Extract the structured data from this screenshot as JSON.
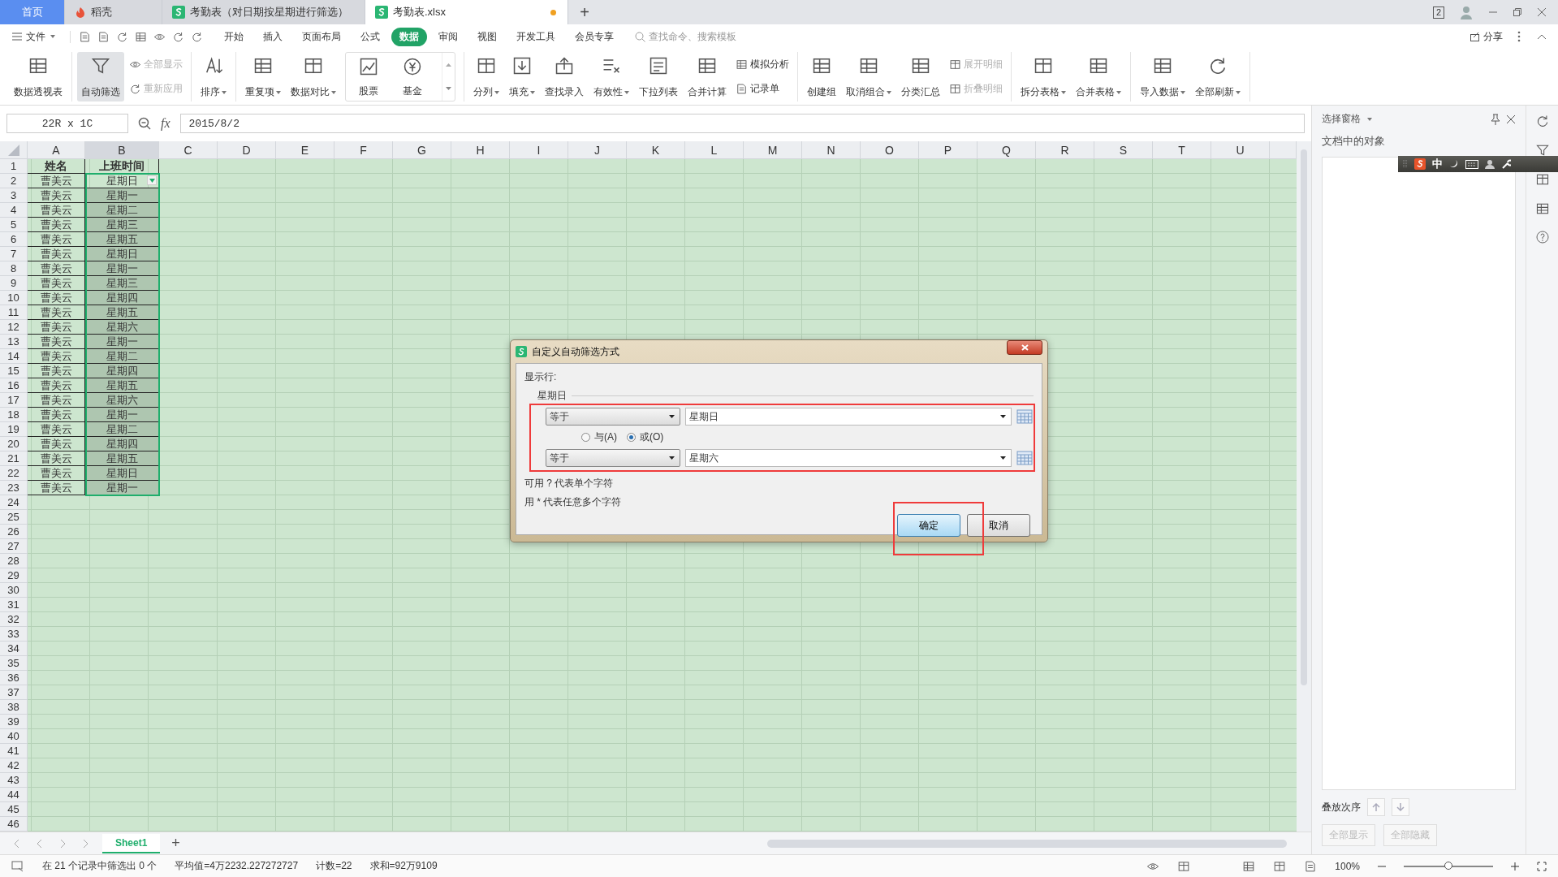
{
  "tabs": [
    {
      "label": "首页",
      "kind": "home",
      "selected": false,
      "modified": false
    },
    {
      "label": "稻壳",
      "kind": "docer",
      "selected": false,
      "modified": false
    },
    {
      "label": "考勤表（对日期按星期进行筛选）",
      "kind": "sheet",
      "selected": false,
      "modified": false
    },
    {
      "label": "考勤表.xlsx",
      "kind": "sheet",
      "selected": true,
      "modified": true
    }
  ],
  "new_tab": "+",
  "window_badge": "2",
  "menu": {
    "file": "文件",
    "items": [
      {
        "label": "开始",
        "selected": false
      },
      {
        "label": "插入",
        "selected": false
      },
      {
        "label": "页面布局",
        "selected": false
      },
      {
        "label": "公式",
        "selected": false
      },
      {
        "label": "数据",
        "selected": true
      },
      {
        "label": "审阅",
        "selected": false
      },
      {
        "label": "视图",
        "selected": false
      },
      {
        "label": "开发工具",
        "selected": false
      },
      {
        "label": "会员专享",
        "selected": false
      }
    ],
    "search_placeholder": "查找命令、搜索模板",
    "share": "分享"
  },
  "ribbon": [
    {
      "items": [
        {
          "kind": "large",
          "label": "数据透视表",
          "selected": false,
          "disabled": false,
          "dropdown": false
        }
      ]
    },
    {
      "items": [
        {
          "kind": "large",
          "label": "自动筛选",
          "selected": true,
          "disabled": false,
          "dropdown": false
        },
        {
          "kind": "stack",
          "items": [
            {
              "label": "全部显示",
              "disabled": true
            },
            {
              "label": "重新应用",
              "disabled": true
            }
          ]
        }
      ]
    },
    {
      "items": [
        {
          "kind": "large",
          "label": "排序",
          "selected": false,
          "disabled": false,
          "dropdown": true
        }
      ]
    },
    {
      "items": [
        {
          "kind": "large",
          "label": "重复项",
          "selected": false,
          "disabled": false,
          "dropdown": true
        },
        {
          "kind": "large",
          "label": "数据对比",
          "selected": false,
          "disabled": false,
          "dropdown": true
        },
        {
          "kind": "gallery",
          "items": [
            {
              "label": "股票"
            },
            {
              "label": "基金"
            }
          ]
        }
      ]
    },
    {
      "items": [
        {
          "kind": "large",
          "label": "分列",
          "selected": false,
          "disabled": false,
          "dropdown": true
        },
        {
          "kind": "large",
          "label": "填充",
          "selected": false,
          "disabled": false,
          "dropdown": true
        },
        {
          "kind": "large",
          "label": "查找录入",
          "selected": false,
          "disabled": false,
          "dropdown": false
        },
        {
          "kind": "large",
          "label": "有效性",
          "selected": false,
          "disabled": false,
          "dropdown": true
        },
        {
          "kind": "large",
          "label": "下拉列表",
          "selected": false,
          "disabled": false,
          "dropdown": false
        },
        {
          "kind": "large",
          "label": "合并计算",
          "selected": false,
          "disabled": false,
          "dropdown": false
        },
        {
          "kind": "stack",
          "items": [
            {
              "label": "模拟分析",
              "disabled": false
            },
            {
              "label": "记录单",
              "disabled": false
            }
          ]
        }
      ]
    },
    {
      "items": [
        {
          "kind": "large",
          "label": "创建组",
          "selected": false,
          "disabled": false,
          "dropdown": false
        },
        {
          "kind": "large",
          "label": "取消组合",
          "selected": false,
          "disabled": false,
          "dropdown": true
        },
        {
          "kind": "large",
          "label": "分类汇总",
          "selected": false,
          "disabled": false,
          "dropdown": false
        },
        {
          "kind": "stack",
          "items": [
            {
              "label": "展开明细",
              "disabled": true
            },
            {
              "label": "折叠明细",
              "disabled": true
            }
          ]
        }
      ]
    },
    {
      "items": [
        {
          "kind": "large",
          "label": "拆分表格",
          "selected": false,
          "disabled": false,
          "dropdown": true
        },
        {
          "kind": "large",
          "label": "合并表格",
          "selected": false,
          "disabled": false,
          "dropdown": true
        }
      ]
    },
    {
      "items": [
        {
          "kind": "large",
          "label": "导入数据",
          "selected": false,
          "disabled": false,
          "dropdown": true
        },
        {
          "kind": "large",
          "label": "全部刷新",
          "selected": false,
          "disabled": false,
          "dropdown": true
        }
      ]
    }
  ],
  "formula_bar": {
    "name_box": "22R x 1C",
    "fx": "fx",
    "value": "2015/8/2"
  },
  "sheet": {
    "columns": [
      {
        "label": "A",
        "selected": false
      },
      {
        "label": "B",
        "selected": true
      },
      {
        "label": "C",
        "selected": false
      },
      {
        "label": "D",
        "selected": false
      },
      {
        "label": "E",
        "selected": false
      },
      {
        "label": "F",
        "selected": false
      },
      {
        "label": "G",
        "selected": false
      },
      {
        "label": "H",
        "selected": false
      },
      {
        "label": "I",
        "selected": false
      },
      {
        "label": "J",
        "selected": false
      },
      {
        "label": "K",
        "selected": false
      },
      {
        "label": "L",
        "selected": false
      },
      {
        "label": "M",
        "selected": false
      },
      {
        "label": "N",
        "selected": false
      },
      {
        "label": "O",
        "selected": false
      },
      {
        "label": "P",
        "selected": false
      },
      {
        "label": "Q",
        "selected": false
      },
      {
        "label": "R",
        "selected": false
      },
      {
        "label": "S",
        "selected": false
      },
      {
        "label": "T",
        "selected": false
      },
      {
        "label": "U",
        "selected": false
      }
    ],
    "row_numbers": [
      "1",
      "2",
      "3",
      "4",
      "5",
      "6",
      "7",
      "8",
      "9",
      "10",
      "11",
      "12",
      "13",
      "14",
      "15",
      "16",
      "17",
      "18",
      "19",
      "20",
      "21",
      "22",
      "23",
      "24",
      "25",
      "26",
      "27",
      "28",
      "29",
      "30",
      "31",
      "32",
      "33",
      "34",
      "35",
      "36",
      "37",
      "38",
      "39",
      "40",
      "41",
      "42",
      "43",
      "44",
      "45",
      "46"
    ],
    "rows": [
      {
        "cells": [
          "姓名",
          "上班时间"
        ],
        "header": true,
        "selected": false
      },
      {
        "cells": [
          "曹美云",
          "星期日"
        ],
        "header": false,
        "selected": false,
        "filter_button": true
      },
      {
        "cells": [
          "曹美云",
          "星期一"
        ],
        "header": false,
        "selected": true
      },
      {
        "cells": [
          "曹美云",
          "星期二"
        ],
        "header": false,
        "selected": true
      },
      {
        "cells": [
          "曹美云",
          "星期三"
        ],
        "header": false,
        "selected": true
      },
      {
        "cells": [
          "曹美云",
          "星期五"
        ],
        "header": false,
        "selected": true
      },
      {
        "cells": [
          "曹美云",
          "星期日"
        ],
        "header": false,
        "selected": true
      },
      {
        "cells": [
          "曹美云",
          "星期一"
        ],
        "header": false,
        "selected": true
      },
      {
        "cells": [
          "曹美云",
          "星期三"
        ],
        "header": false,
        "selected": true
      },
      {
        "cells": [
          "曹美云",
          "星期四"
        ],
        "header": false,
        "selected": true
      },
      {
        "cells": [
          "曹美云",
          "星期五"
        ],
        "header": false,
        "selected": true
      },
      {
        "cells": [
          "曹美云",
          "星期六"
        ],
        "header": false,
        "selected": true
      },
      {
        "cells": [
          "曹美云",
          "星期一"
        ],
        "header": false,
        "selected": true
      },
      {
        "cells": [
          "曹美云",
          "星期二"
        ],
        "header": false,
        "selected": true
      },
      {
        "cells": [
          "曹美云",
          "星期四"
        ],
        "header": false,
        "selected": true
      },
      {
        "cells": [
          "曹美云",
          "星期五"
        ],
        "header": false,
        "selected": true
      },
      {
        "cells": [
          "曹美云",
          "星期六"
        ],
        "header": false,
        "selected": true
      },
      {
        "cells": [
          "曹美云",
          "星期一"
        ],
        "header": false,
        "selected": true
      },
      {
        "cells": [
          "曹美云",
          "星期二"
        ],
        "header": false,
        "selected": true
      },
      {
        "cells": [
          "曹美云",
          "星期四"
        ],
        "header": false,
        "selected": true
      },
      {
        "cells": [
          "曹美云",
          "星期五"
        ],
        "header": false,
        "selected": true
      },
      {
        "cells": [
          "曹美云",
          "星期日"
        ],
        "header": false,
        "selected": true
      },
      {
        "cells": [
          "曹美云",
          "星期一"
        ],
        "header": false,
        "selected": true
      }
    ],
    "sheet_tabs": [
      {
        "label": "Sheet1",
        "selected": true
      }
    ],
    "add_sheet": "+"
  },
  "dialog": {
    "title": "自定义自动筛选方式",
    "show_rows": "显示行:",
    "field": "星期日",
    "conditions": [
      {
        "operator": "等于",
        "value": "星期日"
      },
      {
        "operator": "等于",
        "value": "星期六"
      }
    ],
    "logic": [
      {
        "label": "与(A)",
        "selected": false
      },
      {
        "label": "或(O)",
        "selected": true
      }
    ],
    "hints": [
      "可用 ? 代表单个字符",
      "用 * 代表任意多个字符"
    ],
    "conditions_highlighted": true,
    "buttons": [
      {
        "label": "确定",
        "default": true,
        "highlighted": true
      },
      {
        "label": "取消",
        "default": false,
        "highlighted": false
      }
    ]
  },
  "side_pane": {
    "title": "选择窗格",
    "objects_label": "文档中的对象",
    "order_label": "叠放次序",
    "buttons": [
      {
        "label": "全部显示",
        "disabled": true
      },
      {
        "label": "全部隐藏",
        "disabled": true
      }
    ]
  },
  "ime": {
    "mode": "中"
  },
  "status_bar": {
    "texts": [
      "在 21 个记录中筛选出 0 个",
      "平均值=4万2232.227272727",
      "计数=22",
      "求和=92万9109"
    ],
    "zoom": {
      "label": "100%",
      "level": 0.5
    }
  }
}
